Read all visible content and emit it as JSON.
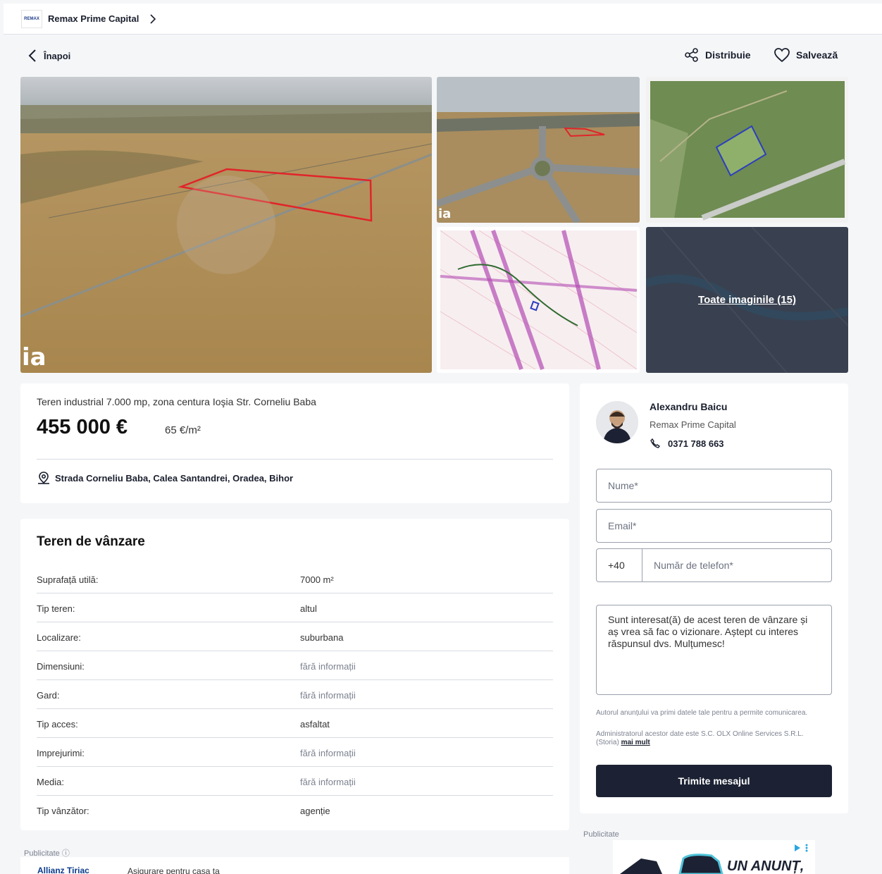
{
  "header": {
    "agency_name": "Remax Prime Capital",
    "agency_logo_text": "REMAX"
  },
  "nav": {
    "back_label": "Înapoi",
    "share_label": "Distribuie",
    "save_label": "Salvează"
  },
  "gallery": {
    "all_photos_label": "Toate imaginile (15)",
    "watermark_text": "ia"
  },
  "listing": {
    "title": "Teren industrial 7.000 mp, zona centura Ioşia Str. Corneliu Baba",
    "price": "455 000 €",
    "price_per_m2": "65 €/m²",
    "address": "Strada Corneliu Baba, Calea Santandrei, Oradea, Bihor"
  },
  "details": {
    "heading": "Teren de vânzare",
    "rows": [
      {
        "key": "Suprafață utilă:",
        "value": "7000 m²"
      },
      {
        "key": "Tip teren:",
        "value": "altul"
      },
      {
        "key": "Localizare:",
        "value": "suburbana"
      },
      {
        "key": "Dimensiuni:",
        "value": "fără informații"
      },
      {
        "key": "Gard:",
        "value": "fără informații"
      },
      {
        "key": "Tip acces:",
        "value": "asfaltat"
      },
      {
        "key": "Imprejurimi:",
        "value": "fără informații"
      },
      {
        "key": "Media:",
        "value": "fără informații"
      },
      {
        "key": "Tip vânzător:",
        "value": "agenție"
      }
    ]
  },
  "contact": {
    "agent_name": "Alexandru Baicu",
    "agent_agency": "Remax Prime Capital",
    "agent_phone": "0371 788 663",
    "name_placeholder": "Nume*",
    "email_placeholder": "Email*",
    "phone_prefix": "+40",
    "phone_placeholder": "Număr de telefon*",
    "message": "Sunt interesat(ă) de acest teren de vânzare și aș vrea să fac o vizionare. Aștept cu interes răspunsul dvs. Mulțumesc!",
    "legal_1": "Autorul anunțului va primi datele tale pentru a permite comunicarea.",
    "legal_2": "Administratorul acestor date este S.C. OLX Online Services S.R.L. (Storia)",
    "legal_more": "mai mult",
    "send_label": "Trimite mesajul"
  },
  "ads": {
    "label_left": "Publicitate",
    "label_right": "Publicitate",
    "left_brand": "Allianz Tiriac",
    "left_text": "Asigurare pentru casa ta",
    "right_headline": "UN ANUNȚ,"
  }
}
